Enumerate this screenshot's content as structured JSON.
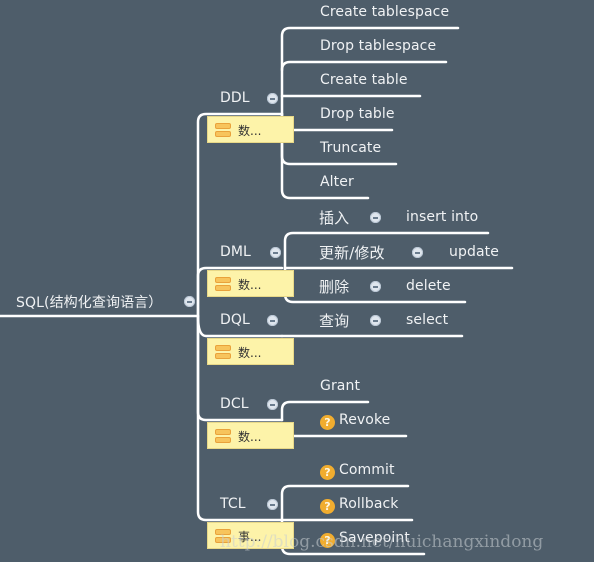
{
  "root": {
    "label": "SQL(结构化查询语言）",
    "icon": "collapse-icon"
  },
  "branches": [
    {
      "label": "DDL",
      "note": "数...",
      "children": [
        "Create tablespace",
        "Drop tablespace",
        "Create  table",
        "Drop table",
        "Truncate",
        "Alter"
      ]
    },
    {
      "label": "DML",
      "note": "数...",
      "children": [
        {
          "label": "插入",
          "value": "insert into"
        },
        {
          "label": "更新/修改",
          "value": "update"
        },
        {
          "label": "删除",
          "value": "delete"
        }
      ]
    },
    {
      "label": "DQL",
      "note": "数...",
      "children": [
        {
          "label": "查询",
          "value": "select"
        }
      ]
    },
    {
      "label": "DCL",
      "note": "数...",
      "children": [
        {
          "label": "Grant",
          "icon": ""
        },
        {
          "label": "Revoke",
          "icon": "question-icon"
        }
      ]
    },
    {
      "label": "TCL",
      "note": "事...",
      "children": [
        {
          "label": "Commit",
          "icon": "question-icon"
        },
        {
          "label": "Rollback",
          "icon": "question-icon"
        },
        {
          "label": "Savepoint",
          "icon": "question-icon"
        }
      ]
    }
  ],
  "question_glyph": "?",
  "watermark": "http://blog.csdn.net/huichangxindong"
}
